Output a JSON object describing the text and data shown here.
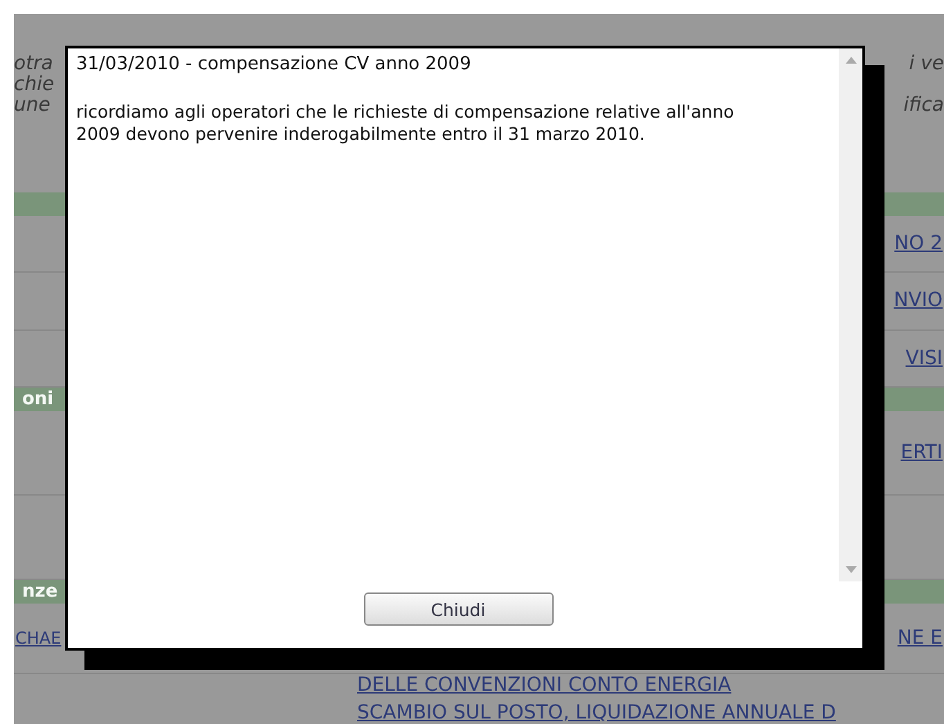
{
  "background": {
    "intro": [
      {
        "left": "otra",
        "right": "i ve"
      },
      {
        "left": "chie"
      },
      {
        "left": "une",
        "right": "ifica"
      }
    ],
    "sections": [
      {
        "rows": [
          {
            "right": "NO 2"
          },
          {
            "right": "NVIO"
          },
          {
            "right": "VISI"
          }
        ]
      },
      {
        "label": "oni",
        "rows": [
          {
            "right": "ERTI"
          },
          {}
        ]
      },
      {
        "label": "nze",
        "rows": [
          {
            "left": "CHAE",
            "right": "NE E"
          }
        ]
      }
    ],
    "news": [
      "DELLE CONVENZIONI CONTO ENERGIA",
      "SCAMBIO SUL POSTO, LIQUIDAZIONE ANNUALE D"
    ]
  },
  "dialog": {
    "title": "31/03/2010 - compensazione CV anno 2009",
    "message": "ricordiamo agli operatori che le richieste di compensazione relative all'anno 2009 devono pervenire inderogabilmente entro il 31 marzo 2010.",
    "button": "Chiudi"
  }
}
